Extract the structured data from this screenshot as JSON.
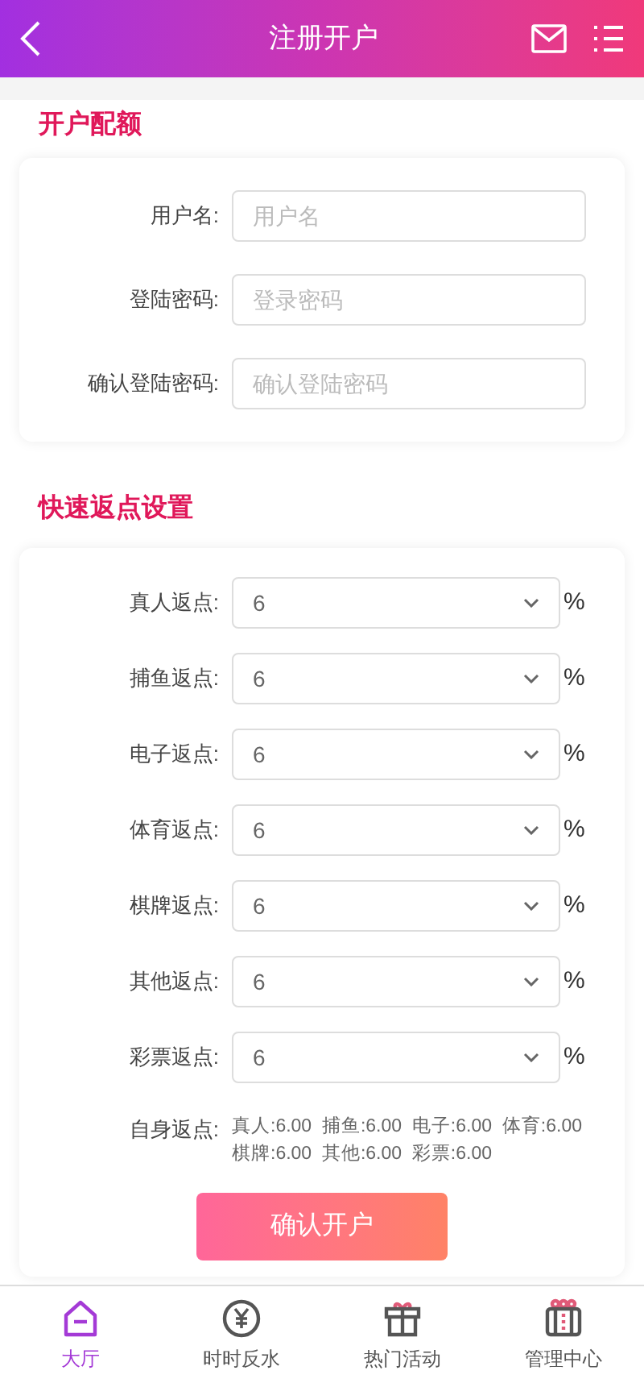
{
  "header": {
    "title": "注册开户"
  },
  "account_section": {
    "title": "开户配额",
    "fields": [
      {
        "label": "用户名:",
        "placeholder": "用户名"
      },
      {
        "label": "登陆密码:",
        "placeholder": "登录密码"
      },
      {
        "label": "确认登陆密码:",
        "placeholder": "确认登陆密码"
      }
    ]
  },
  "rebate_section": {
    "title": "快速返点设置",
    "rows": [
      {
        "label": "真人返点:",
        "value": "6",
        "unit": "%"
      },
      {
        "label": "捕鱼返点:",
        "value": "6",
        "unit": "%"
      },
      {
        "label": "电子返点:",
        "value": "6",
        "unit": "%"
      },
      {
        "label": "体育返点:",
        "value": "6",
        "unit": "%"
      },
      {
        "label": "棋牌返点:",
        "value": "6",
        "unit": "%"
      },
      {
        "label": "其他返点:",
        "value": "6",
        "unit": "%"
      },
      {
        "label": "彩票返点:",
        "value": "6",
        "unit": "%"
      }
    ],
    "self_rebate": {
      "label": "自身返点:",
      "text": "真人:6.00  捕鱼:6.00  电子:6.00  体育:6.00  棋牌:6.00  其他:6.00  彩票:6.00"
    }
  },
  "submit_button": "确认开户",
  "bottom_nav": [
    {
      "label": "大厅",
      "kind": "home",
      "selected": true
    },
    {
      "label": "时时反水",
      "kind": "yen",
      "selected": false
    },
    {
      "label": "热门活动",
      "kind": "gift",
      "selected": false
    },
    {
      "label": "管理中心",
      "kind": "box",
      "selected": false
    }
  ]
}
